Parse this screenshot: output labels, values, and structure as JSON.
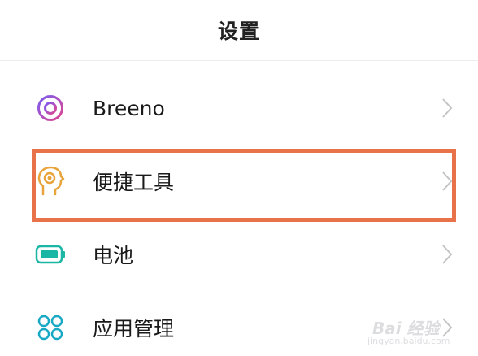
{
  "header": {
    "title": "设置"
  },
  "items": [
    {
      "label": "Breeno",
      "icon": "breeno-icon"
    },
    {
      "label": "便捷工具",
      "icon": "head-tools-icon"
    },
    {
      "label": "电池",
      "icon": "battery-icon"
    },
    {
      "label": "应用管理",
      "icon": "app-grid-icon"
    }
  ],
  "watermark": {
    "main": "Bai 经验",
    "sub": "jingyan.baidu.com"
  },
  "colors": {
    "highlight": "#e8734a",
    "battery": "#1cb6a5",
    "apps": "#17a8c4",
    "breeno": "#b04fc9",
    "tools": "#e8a33a",
    "chevron": "#c4c4c4"
  }
}
